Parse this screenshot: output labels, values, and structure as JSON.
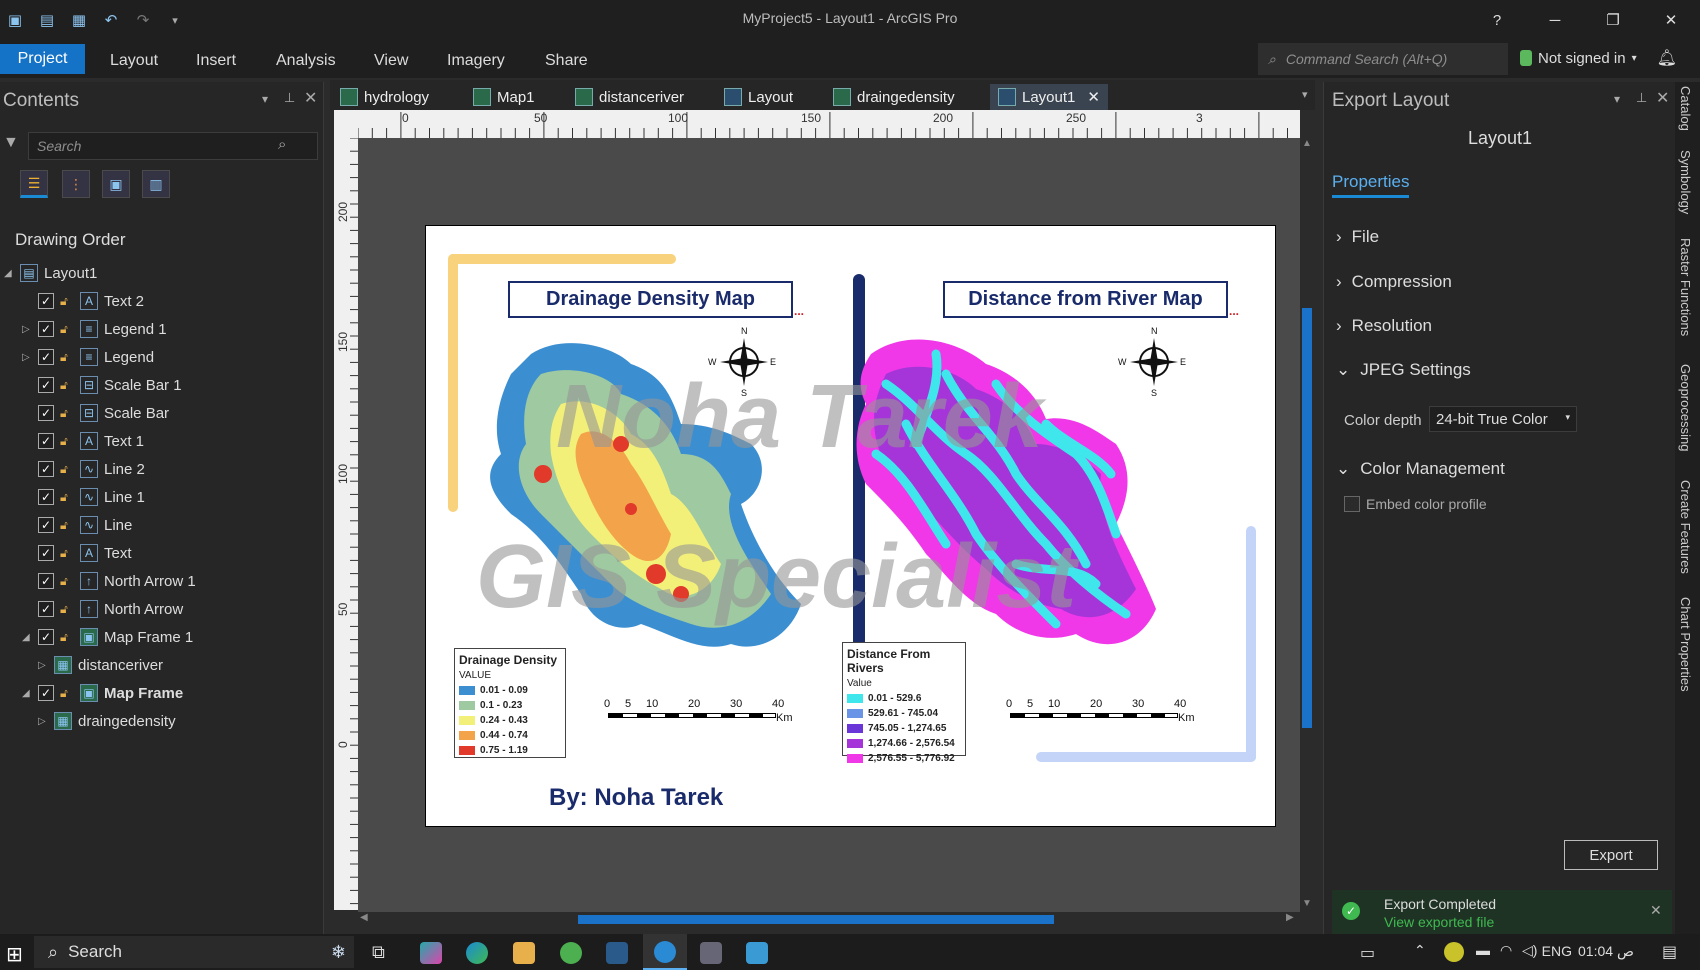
{
  "window": {
    "title": "MyProject5 - Layout1 - ArcGIS Pro",
    "help": "?"
  },
  "ribbon": {
    "tabs": [
      "Project",
      "Layout",
      "Insert",
      "Analysis",
      "View",
      "Imagery",
      "Share"
    ],
    "command_search_placeholder": "Command Search (Alt+Q)",
    "signin": "Not signed in"
  },
  "contents": {
    "title": "Contents",
    "search_placeholder": "Search",
    "drawing_order": "Drawing Order",
    "root": "Layout1",
    "items": [
      {
        "label": "Text 2",
        "icon": "text-element-icon"
      },
      {
        "label": "Legend 1",
        "icon": "legend-icon"
      },
      {
        "label": "Legend",
        "icon": "legend-icon"
      },
      {
        "label": "Scale Bar 1",
        "icon": "scale-bar-icon"
      },
      {
        "label": "Scale Bar",
        "icon": "scale-bar-icon"
      },
      {
        "label": "Text 1",
        "icon": "text-element-icon"
      },
      {
        "label": "Line 2",
        "icon": "line-icon"
      },
      {
        "label": "Line 1",
        "icon": "line-icon"
      },
      {
        "label": "Line",
        "icon": "line-icon"
      },
      {
        "label": "Text",
        "icon": "text-element-icon"
      },
      {
        "label": "North Arrow 1",
        "icon": "north-arrow-icon"
      },
      {
        "label": "North Arrow",
        "icon": "north-arrow-icon"
      },
      {
        "label": "Map Frame 1",
        "icon": "map-frame-icon"
      },
      {
        "label": "distanceriver",
        "icon": "map-icon"
      },
      {
        "label": "Map Frame",
        "icon": "map-frame-icon"
      },
      {
        "label": "draingedensity",
        "icon": "map-icon"
      }
    ]
  },
  "view_tabs": [
    "hydrology",
    "Map1",
    "distanceriver",
    "Layout",
    "draingedensity",
    "Layout1"
  ],
  "rulers": {
    "h": [
      "0",
      "50",
      "100",
      "150",
      "200",
      "250",
      "3"
    ],
    "v": [
      "200",
      "150",
      "100",
      "50",
      "0"
    ]
  },
  "layout": {
    "title_left": "Drainage Density Map",
    "title_right": "Distance from River Map",
    "byline": "By: Noha Tarek",
    "north": {
      "n": "N",
      "s": "S",
      "e": "E",
      "w": "W"
    },
    "watermark_1": "Noha Tarek",
    "watermark_2": "GIS Specialist",
    "legend_left": {
      "title": "Drainage Density",
      "subtitle": "VALUE",
      "rows": [
        {
          "label": "0.01 - 0.09",
          "color": "#3b8fd1"
        },
        {
          "label": "0.1 - 0.23",
          "color": "#9fc9a0"
        },
        {
          "label": "0.24 - 0.43",
          "color": "#f3f07a"
        },
        {
          "label": "0.44 - 0.74",
          "color": "#f3a44a"
        },
        {
          "label": "0.75 - 1.19",
          "color": "#e13a2a"
        }
      ]
    },
    "legend_right": {
      "title": "Distance From Rivers",
      "subtitle": "Value",
      "rows": [
        {
          "label": "0.01 - 529.6",
          "color": "#3fe6ec"
        },
        {
          "label": "529.61 - 745.04",
          "color": "#6a95e6"
        },
        {
          "label": "745.05 - 1,274.65",
          "color": "#6a36d8"
        },
        {
          "label": "1,274.66 - 2,576.54",
          "color": "#a535d8"
        },
        {
          "label": "2,576.55 - 5,776.92",
          "color": "#f038e8"
        }
      ]
    },
    "scalebar": {
      "ticks": [
        "0",
        "5",
        "10",
        "20",
        "30",
        "40"
      ],
      "unit": "Km"
    }
  },
  "export_pane": {
    "title": "Export Layout",
    "layout_name": "Layout1",
    "tab": "Properties",
    "sections": [
      "File",
      "Compression",
      "Resolution",
      "JPEG Settings",
      "Color Management"
    ],
    "color_depth_label": "Color depth",
    "color_depth_value": "24-bit True Color",
    "embed_label": "Embed color profile",
    "export_button": "Export",
    "toast_title": "Export Completed",
    "toast_link": "View exported file"
  },
  "side_tabs": [
    "Catalog",
    "Symbology",
    "Raster Functions",
    "Geoprocessing",
    "Create Features",
    "Chart Properties"
  ],
  "taskbar": {
    "search": "Search",
    "lang": "ENG",
    "time": "01:04 ص"
  }
}
